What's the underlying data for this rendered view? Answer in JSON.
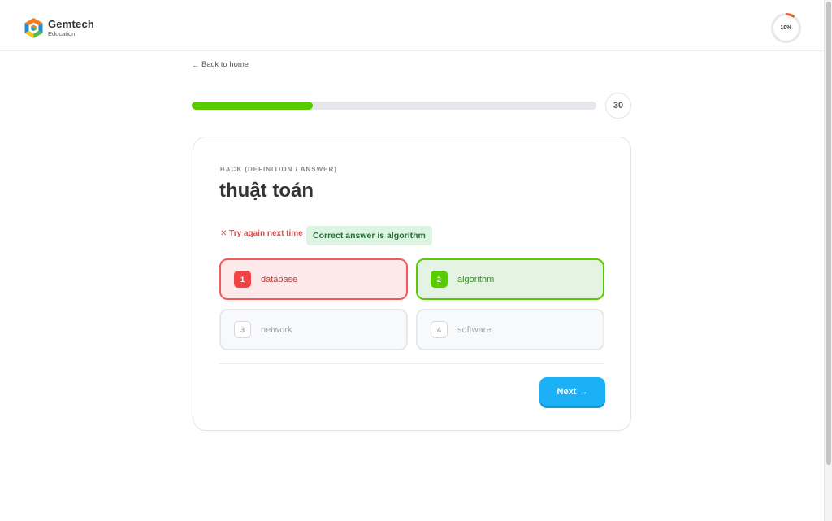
{
  "brand": {
    "name": "Gemtech",
    "subtitle": "Education",
    "logo_icon": "hexagon-cube-logo",
    "colors": {
      "orange": "#f47c20",
      "blue": "#1f8fd6",
      "green": "#58b947",
      "yellow": "#f6c31a"
    }
  },
  "header": {
    "progress_label": "10%",
    "progress_fraction": 0.1,
    "progress_color": "#e8602c"
  },
  "nav": {
    "back_label": "Back to home",
    "back_icon": "arrow-left-icon"
  },
  "quiz": {
    "progress_fraction": 0.3,
    "progress_color": "#58cc02",
    "counter": "30"
  },
  "card": {
    "label": "BACK (DEFINITION / ANSWER)",
    "term": "thuật toán",
    "feedback_wrong": "✕ Try again next time",
    "feedback_correct": "Correct answer is algorithm",
    "options": [
      {
        "number": "1",
        "text": "database",
        "state": "wrong"
      },
      {
        "number": "2",
        "text": "algorithm",
        "state": "correct"
      },
      {
        "number": "3",
        "text": "network",
        "state": "neutral"
      },
      {
        "number": "4",
        "text": "software",
        "state": "neutral"
      }
    ],
    "next_label": "Next →"
  },
  "colors": {
    "wrong": "#ef4444",
    "correct": "#58cc02",
    "primary_button": "#1cb0f6"
  }
}
